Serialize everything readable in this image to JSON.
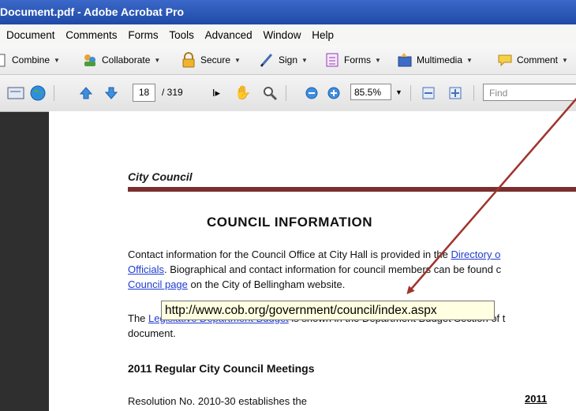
{
  "window": {
    "title": "Document.pdf - Adobe Acrobat Pro"
  },
  "menu": [
    "Document",
    "Comments",
    "Forms",
    "Tools",
    "Advanced",
    "Window",
    "Help"
  ],
  "tasks": [
    {
      "label": "Combine",
      "icon": "combine-icon"
    },
    {
      "label": "Collaborate",
      "icon": "collaborate-icon"
    },
    {
      "label": "Secure",
      "icon": "lock-icon"
    },
    {
      "label": "Sign",
      "icon": "pen-icon"
    },
    {
      "label": "Forms",
      "icon": "form-icon"
    },
    {
      "label": "Multimedia",
      "icon": "multimedia-icon"
    },
    {
      "label": "Comment",
      "icon": "comment-icon"
    }
  ],
  "toolbar": {
    "page_current": "18",
    "page_total": "/ 319",
    "zoom": "85.5%",
    "find_placeholder": "Find"
  },
  "document": {
    "section_title": "City Council",
    "heading": "COUNCIL INFORMATION",
    "para1_a": "Contact information for the Council Office at City Hall is provided in the ",
    "para1_link": "Directory o",
    "para2_link": "Officials",
    "para2_b": ".  Biographical and contact information for council members can be found c",
    "para3_link": "Council page",
    "para3_b": " on the City of Bellingham website.",
    "para4_a": "The ",
    "para4_link": "Legislative Department Budget",
    "para4_b": " is shown in the Department Budget Section of t",
    "para5": "document.",
    "subheading": "2011 Regular City Council Meetings",
    "para6": "Resolution No. 2010-30 establishes the",
    "year": "2011"
  },
  "tooltip": {
    "text": "http://www.cob.org/government/council/index.aspx"
  },
  "colors": {
    "titlebar": "#2a58b8",
    "rule": "#7a2e2e",
    "link": "#1f3ccf",
    "arrow": "#a0342d"
  }
}
